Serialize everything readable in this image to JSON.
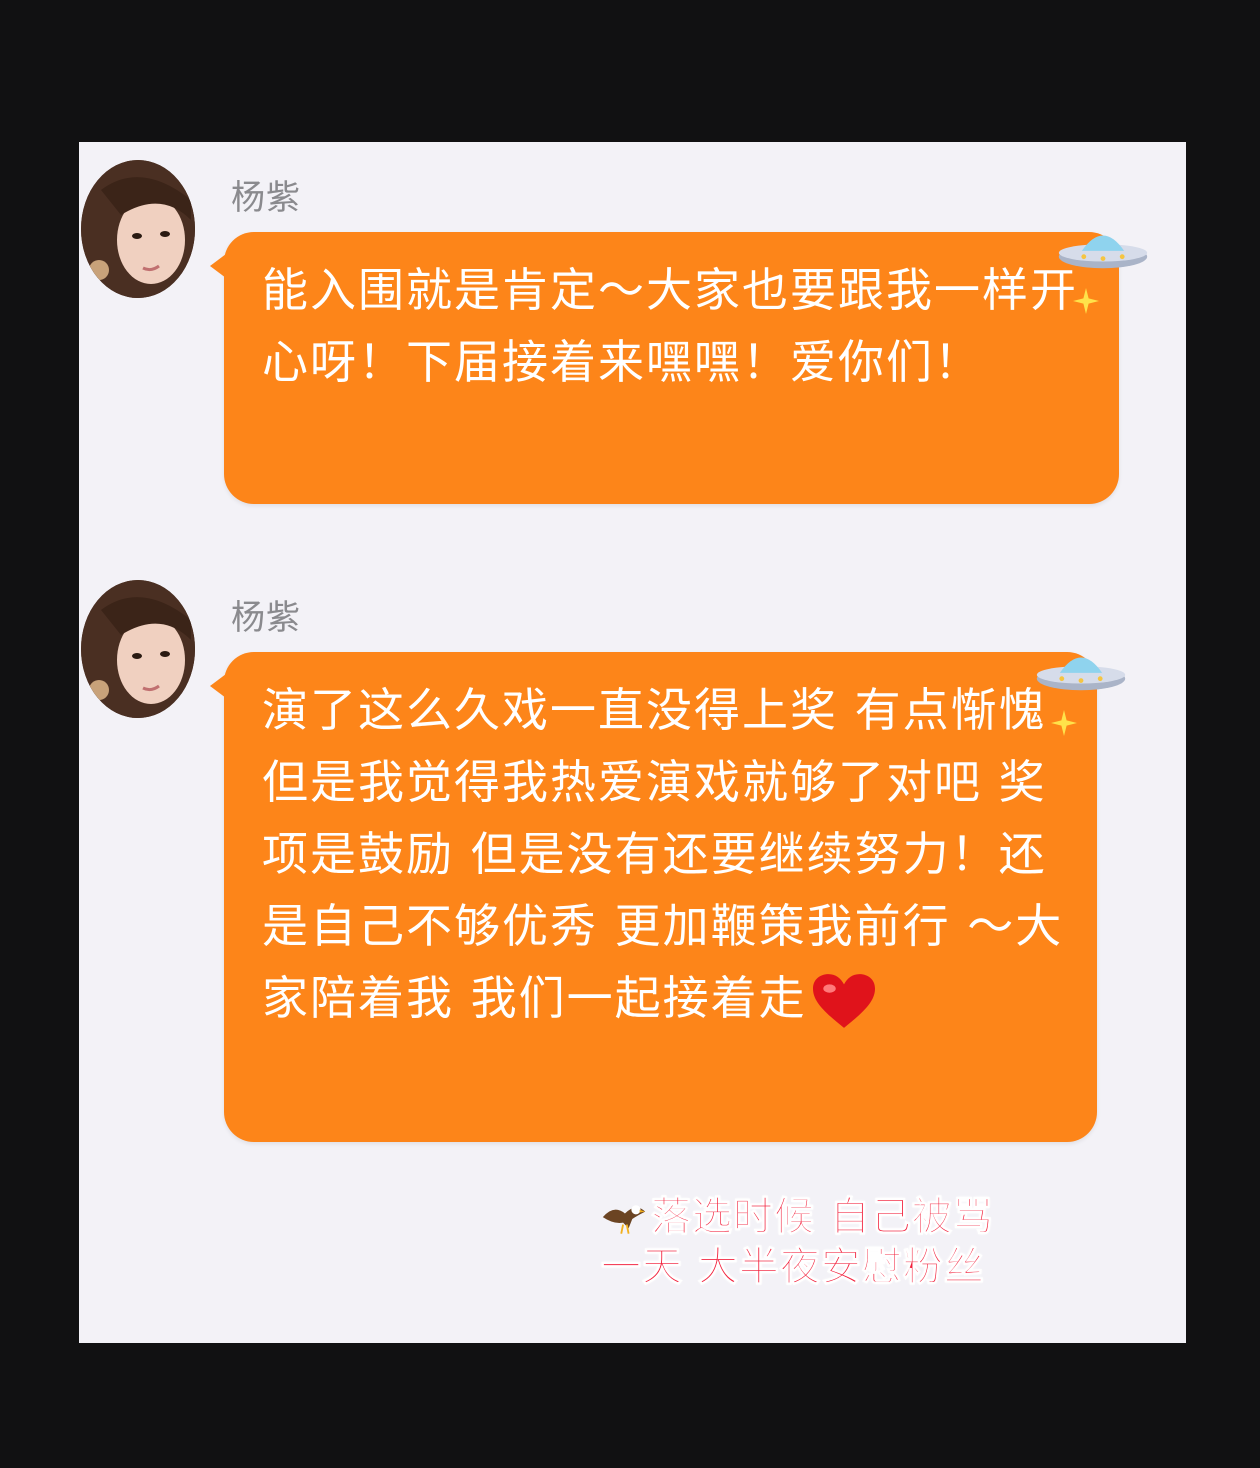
{
  "messages": [
    {
      "sender": "杨紫",
      "text": "能入围就是肯定～大家也要跟我一样开心呀！下届接着来嘿嘿！爱你们！"
    },
    {
      "sender": "杨紫",
      "text": "演了这么久戏一直没得上奖 有点惭愧 但是我觉得我热爱演戏就够了对吧 奖项是鼓励 但是没有还要继续努力！还是自己不够优秀 更加鞭策我前行 ～大家陪着我 我们一起接着走"
    }
  ],
  "caption": {
    "line1": "落选时候 自己被骂",
    "line2": "一天 大半夜安慰粉丝"
  },
  "colors": {
    "bubble": "#fd8519",
    "caption": "#f21f3b"
  },
  "icons": [
    "ufo-icon",
    "sparkle-icon",
    "heart-icon",
    "eagle-icon"
  ]
}
